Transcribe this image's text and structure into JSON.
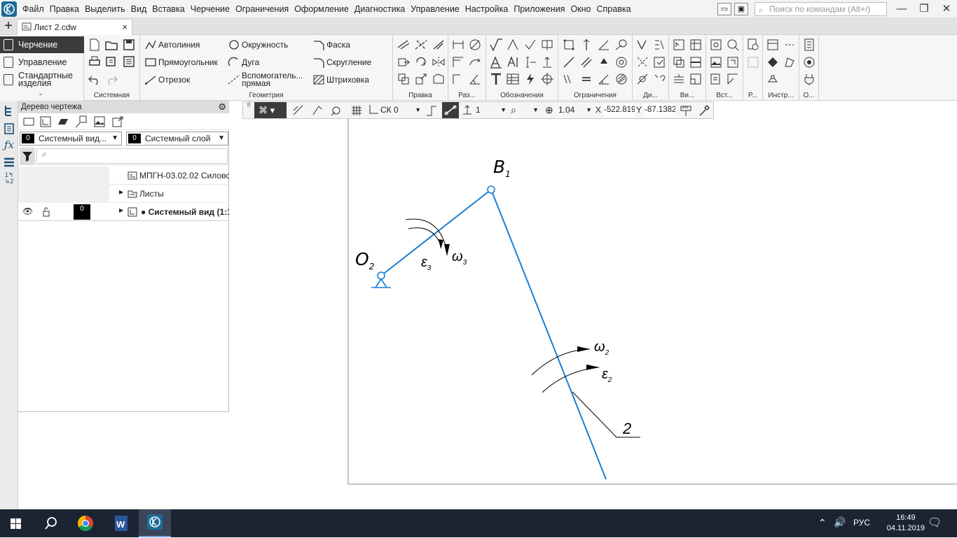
{
  "menu": {
    "items": [
      "Файл",
      "Правка",
      "Выделить",
      "Вид",
      "Вставка",
      "Черчение",
      "Ограничения",
      "Оформление",
      "Диагностика",
      "Управление",
      "Настройка",
      "Приложения",
      "Окно",
      "Справка"
    ],
    "search_placeholder": "Поиск по командам (Alt+/)"
  },
  "tab": {
    "title": "Лист 2.cdw",
    "close": "×",
    "add": "+"
  },
  "ribbon": {
    "left_items": [
      "Черчение",
      "Управление",
      "Стандартные изделия"
    ],
    "groups": {
      "system": "Системная",
      "geometry": "Геометрия",
      "edit": "Правка",
      "dims": "Раз...",
      "annotations": "Обозначения",
      "constraints": "Ограничения",
      "diag": "Ди...",
      "view": "Ви...",
      "insert": "Вст...",
      "r": "Р...",
      "tools": "Инстр...",
      "o": "О..."
    },
    "geometry_commands": [
      "Автолиния",
      "Прямоугольник",
      "Отрезок",
      "Окружность",
      "Дуга",
      "Вспомогатель... прямая",
      "Фаска",
      "Скругление",
      "Штриховка"
    ]
  },
  "tree": {
    "title": "Дерево чертежа",
    "view_select": {
      "num": "0",
      "label": "Системный вид..."
    },
    "layer_select": {
      "num": "0",
      "label": "Системный слой"
    },
    "rows": [
      {
        "label": "МПГН-03.02.02 Силово"
      },
      {
        "label": "Листы"
      },
      {
        "label": "● Системный вид (1:1",
        "layer": "0"
      }
    ]
  },
  "drawing_toolbar": {
    "cs": "СК 0",
    "step": "1",
    "zoom": "1.04",
    "x_label": "X",
    "x_value": "-522.819",
    "y_label": "Y",
    "y_value": "-87.1382"
  },
  "drawing": {
    "label_b1": "B",
    "label_b1_sub": "1",
    "label_o2": "O",
    "label_o2_sub": "2",
    "label_eps3": "ε",
    "label_eps3_sub": "3",
    "label_w3": "ω",
    "label_w3_sub": "3",
    "label_w2": "ω",
    "label_w2_sub": "2",
    "label_eps2": "ε",
    "label_eps2_sub": "2",
    "label_2": "2",
    "line_color": "#1a7fd6"
  },
  "taskbar": {
    "lang": "РУС",
    "time": "16:49",
    "date": "04.11.2019"
  }
}
